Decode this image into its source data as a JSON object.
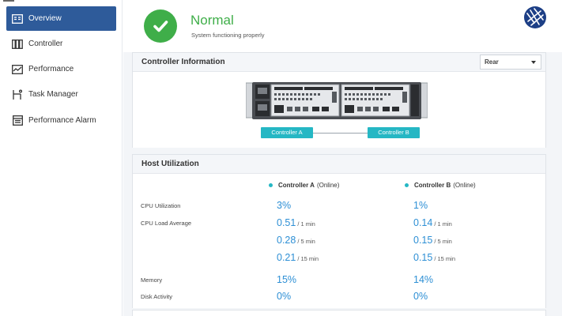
{
  "sidebar": {
    "items": [
      {
        "label": "Overview",
        "icon": "overview-icon",
        "active": true
      },
      {
        "label": "Controller",
        "icon": "controller-icon",
        "active": false
      },
      {
        "label": "Performance",
        "icon": "performance-icon",
        "active": false
      },
      {
        "label": "Task Manager",
        "icon": "task-manager-icon",
        "active": false
      },
      {
        "label": "Performance Alarm",
        "icon": "performance-alarm-icon",
        "active": false
      }
    ]
  },
  "status": {
    "title": "Normal",
    "subtitle": "System functioning properly",
    "color": "#3fae49"
  },
  "controller_info": {
    "title": "Controller Information",
    "view_select": {
      "selected": "Rear"
    },
    "controller_a_label": "Controller A",
    "controller_b_label": "Controller B"
  },
  "host_utilization": {
    "title": "Host Utilization",
    "columns": [
      {
        "name": "Controller A",
        "status": "(Online)"
      },
      {
        "name": "Controller B",
        "status": "(Online)"
      }
    ],
    "labels": {
      "cpu_utilization": "CPU Utilization",
      "cpu_load_average": "CPU Load Average",
      "memory": "Memory",
      "disk_activity": "Disk Activity"
    },
    "controller_a": {
      "cpu": "3%",
      "load_1": "0.51",
      "load_1_unit": "/ 1 min",
      "load_5": "0.28",
      "load_5_unit": "/ 5 min",
      "load_15": "0.21",
      "load_15_unit": "/ 15 min",
      "memory": "15%",
      "disk": "0%"
    },
    "controller_b": {
      "cpu": "1%",
      "load_1": "0.14",
      "load_1_unit": "/ 1 min",
      "load_5": "0.15",
      "load_5_unit": "/ 5 min",
      "load_15": "0.15",
      "load_15_unit": "/ 15 min",
      "memory": "14%",
      "disk": "0%"
    }
  },
  "colors": {
    "accent": "#2e5b9a",
    "teal": "#25b7c4",
    "value_blue": "#2d8fd5",
    "ok_green": "#3fae49"
  }
}
